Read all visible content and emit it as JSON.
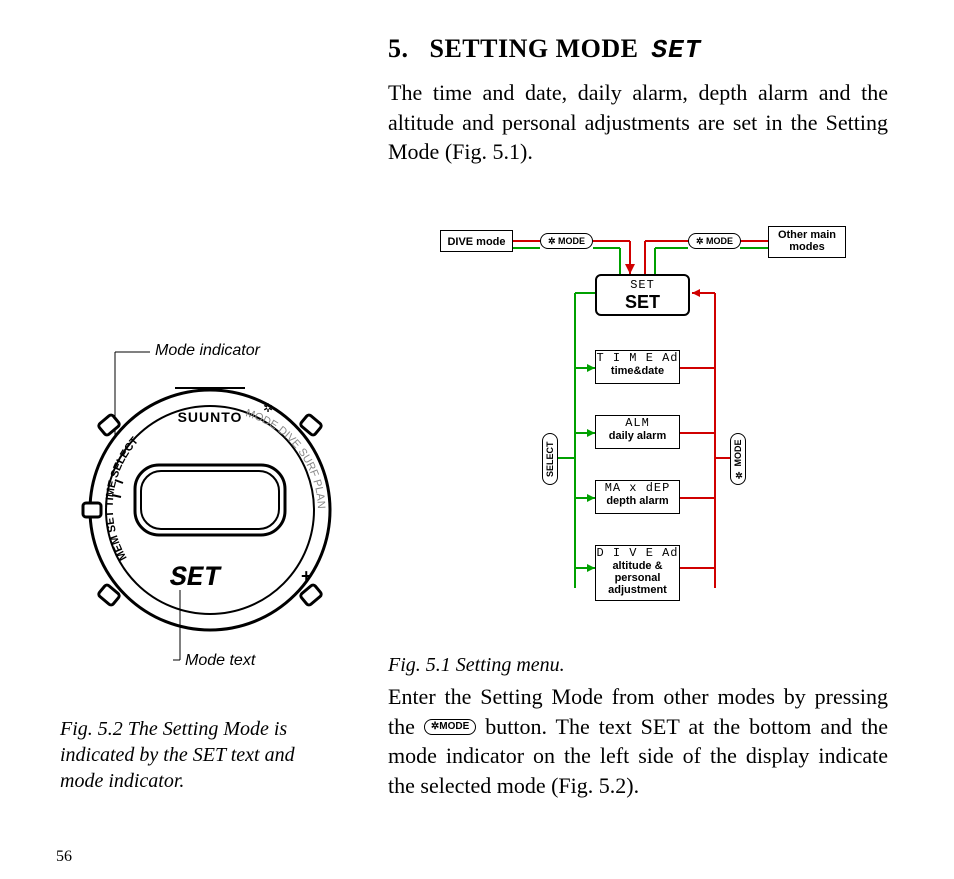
{
  "heading": {
    "number": "5.",
    "title": "SETTING MODE",
    "segment": "SET"
  },
  "intro": "The time and date, daily alarm, depth alarm and the altitude and personal adjustments are set in the Setting Mode (Fig. 5.1).",
  "diagram1": {
    "dive_mode": "DIVE mode",
    "other_modes_l1": "Other main",
    "other_modes_l2": "modes",
    "mode_btn": "✲ MODE",
    "select_btn": "SELECT",
    "set_seg": "SET",
    "set_big": "SET",
    "items": [
      {
        "seg": "T I M E  Ad",
        "label": "time&date"
      },
      {
        "seg": "ALM",
        "label": "daily alarm"
      },
      {
        "seg": "MA x  dEP",
        "label": "depth alarm"
      },
      {
        "seg": "D I V E  Ad",
        "label_l1": "altitude &",
        "label_l2": "personal",
        "label_l3": "adjustment"
      }
    ]
  },
  "fig1_caption": "Fig. 5.1 Setting menu.",
  "p2_a": "Enter the Setting Mode from other modes by pressing the ",
  "p2_btn": "✲MODE",
  "p2_b": " button. The text SET at the bottom and the mode indicator on the left side of the display indicate the selected mode (Fig. 5.2).",
  "diagram2": {
    "mode_indicator_label": "Mode indicator",
    "mode_text_label": "Mode text",
    "brand": "SUUNTO",
    "set_text": "SET",
    "arc_left": [
      "MEM",
      "SET",
      "TIME",
      "SELECT"
    ],
    "arc_right": [
      "MODE",
      "DIVE",
      "SURF",
      "PLAN"
    ],
    "plus": "+"
  },
  "fig2_caption": "Fig. 5.2 The Setting Mode is indicated by the SET text and mode indicator.",
  "page_number": "56"
}
